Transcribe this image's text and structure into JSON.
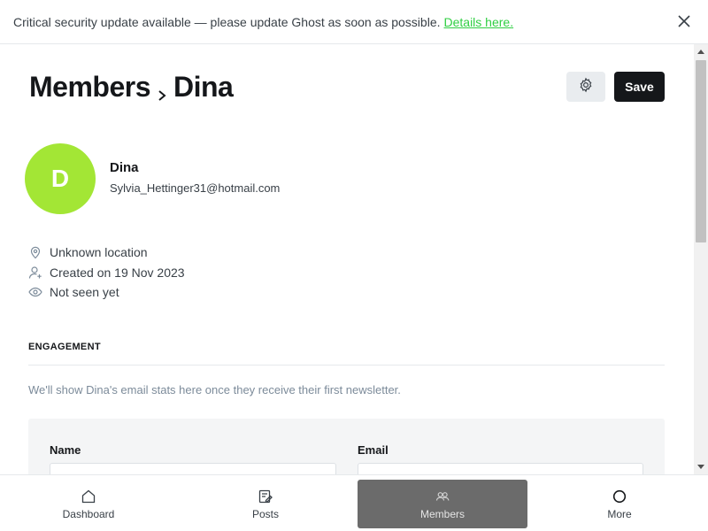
{
  "alert": {
    "message": "Critical security update available — please update Ghost as soon as possible.",
    "link_label": "Details here."
  },
  "breadcrumb": {
    "parent": "Members",
    "current": "Dina"
  },
  "toolbar": {
    "save_label": "Save"
  },
  "member": {
    "initial": "D",
    "name": "Dina",
    "email": "Sylvia_Hettinger31@hotmail.com",
    "avatar_color": "#a3e635",
    "location": "Unknown location",
    "created": "Created on 19 Nov 2023",
    "last_seen": "Not seen yet"
  },
  "engagement": {
    "title": "ENGAGEMENT",
    "text": "We'll show Dina's email stats here once they receive their first newsletter."
  },
  "form": {
    "name_label": "Name",
    "name_value": "",
    "email_label": "Email",
    "email_value": ""
  },
  "nav": {
    "items": [
      {
        "label": "Dashboard",
        "icon": "home-icon",
        "active": false
      },
      {
        "label": "Posts",
        "icon": "posts-icon",
        "active": false
      },
      {
        "label": "Members",
        "icon": "members-icon",
        "active": true
      },
      {
        "label": "More",
        "icon": "more-icon",
        "active": false
      }
    ]
  },
  "colors": {
    "accent_green": "#30cf43",
    "save_bg": "#15171a",
    "active_nav_bg": "#6b6b6b"
  }
}
